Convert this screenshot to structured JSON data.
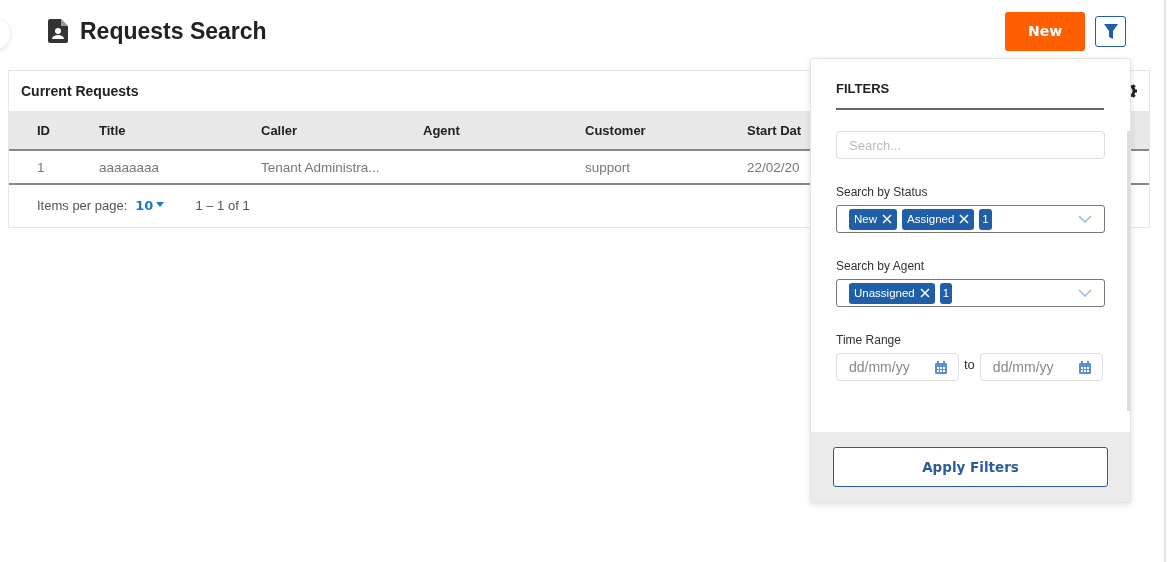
{
  "header": {
    "title": "Requests Search",
    "new_button": "New"
  },
  "card": {
    "title": "Current Requests",
    "columns": [
      "ID",
      "Title",
      "Caller",
      "Agent",
      "Customer",
      "Start Dat"
    ],
    "rows": [
      [
        "1",
        "aaaaaaaa",
        "Tenant Administra...",
        "",
        "support",
        "22/02/20"
      ]
    ],
    "paginator": {
      "label": "Items per page:",
      "page_size": "10",
      "range": "1 – 1 of 1"
    }
  },
  "filters": {
    "title": "FILTERS",
    "search": {
      "placeholder": "Search..."
    },
    "selects": [
      {
        "label": "Search by Status",
        "chips": [
          "New",
          "Assigned"
        ],
        "more": "1"
      },
      {
        "label": "Search by Agent",
        "chips": [
          "Unassigned"
        ],
        "more": "1"
      }
    ],
    "time_range": {
      "label": "Time Range",
      "from": {
        "placeholder": "dd/mm/yy"
      },
      "separator": "to",
      "to": {
        "placeholder": "dd/mm/yy"
      }
    },
    "apply": "Apply Filters"
  }
}
